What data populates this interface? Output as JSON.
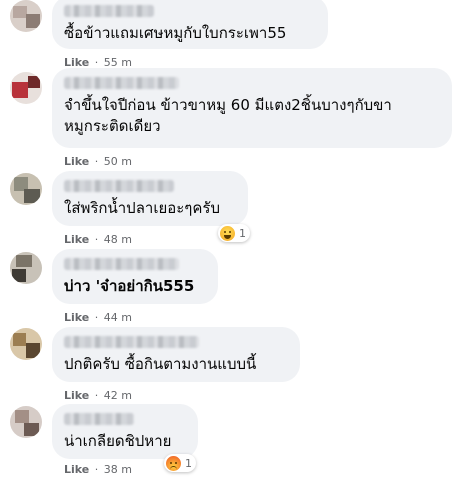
{
  "comments": [
    {
      "text": "ซื้อข้าวแถมเศษหมูกับใบกระเพา55",
      "like_label": "Like",
      "time": "55 m",
      "avatar_colors": [
        "#b8a7a0",
        "#d9cfc9",
        "#8c7c74"
      ]
    },
    {
      "text": "จำขึ้นใจปีก่อน ข้าวขาหมู 60 มีแตง2ชิ้นบางๆกับขา\nหมูกระติดเดียว",
      "like_label": "Like",
      "time": "50 m",
      "avatar_colors": [
        "#b8323a",
        "#e8e0dc",
        "#6e2a2a"
      ]
    },
    {
      "text": "ใส่พริกน้ำปลาเยอะๆครับ",
      "like_label": "Like",
      "time": "48 m",
      "avatar_colors": [
        "#8d8c7e",
        "#c7c0b1",
        "#5d5b52"
      ],
      "reaction": {
        "icon": "laugh-reaction-icon",
        "count": "1"
      }
    },
    {
      "text": "บ่าว 'จ๋าอย่ากิน555",
      "like_label": "Like",
      "time": "44 m",
      "avatar_colors": [
        "#7b7468",
        "#c8c2b8",
        "#3f3b35"
      ],
      "bold": true
    },
    {
      "text": "ปกติครับ ซื้อกินตามงานแบบนี้",
      "like_label": "Like",
      "time": "42 m",
      "avatar_colors": [
        "#9c7e52",
        "#d9c7a8",
        "#5a4630"
      ]
    },
    {
      "text": "น่าเกลียดชิปหาย",
      "like_label": "Like",
      "time": "38 m",
      "avatar_colors": [
        "#a38f86",
        "#d6ccc7",
        "#6c5a53"
      ],
      "reaction": {
        "icon": "angry-reaction-icon",
        "count": "1"
      }
    }
  ],
  "separator": "·"
}
